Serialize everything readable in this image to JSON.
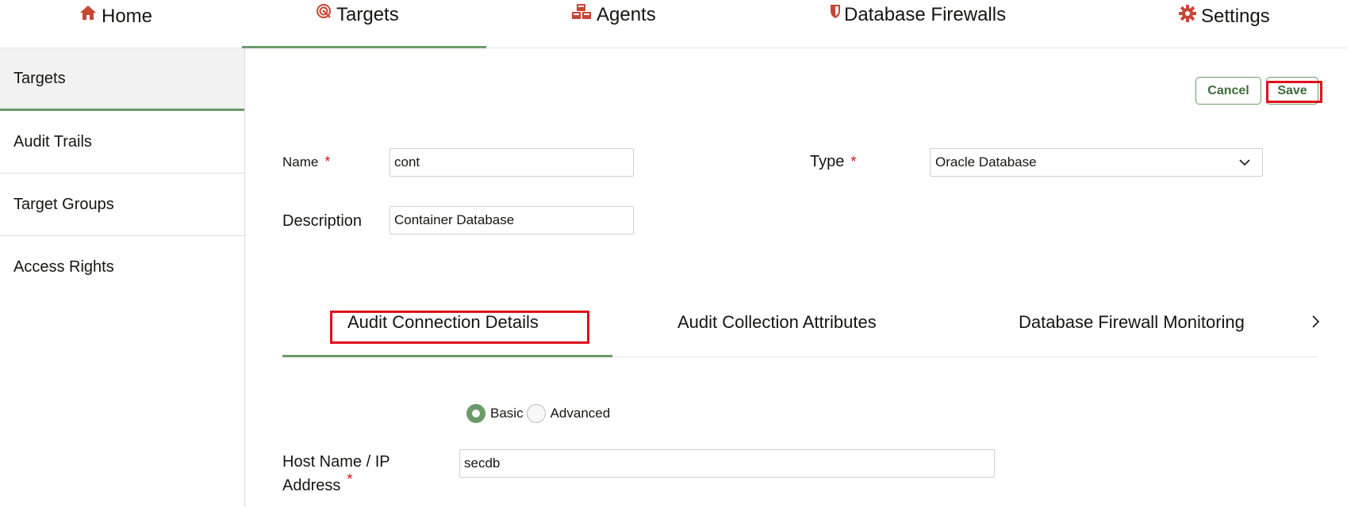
{
  "topnav": {
    "items": [
      {
        "label": "Home",
        "icon": "home-icon"
      },
      {
        "label": "Targets",
        "icon": "target-icon",
        "active": true
      },
      {
        "label": "Agents",
        "icon": "agents-icon"
      },
      {
        "label": "Database Firewalls",
        "icon": "shield-icon"
      },
      {
        "label": "Settings",
        "icon": "gear-icon"
      }
    ]
  },
  "sidebar": {
    "items": [
      {
        "label": "Targets",
        "active": true
      },
      {
        "label": "Audit Trails"
      },
      {
        "label": "Target Groups"
      },
      {
        "label": "Access Rights"
      }
    ]
  },
  "actions": {
    "cancel_label": "Cancel",
    "save_label": "Save"
  },
  "form": {
    "name_label": "Name",
    "name_value": "cont",
    "type_label": "Type",
    "type_value": "Oracle Database",
    "description_label": "Description",
    "description_value": "Container Database",
    "required_mark": "*"
  },
  "tabs": [
    {
      "label": "Audit Connection Details",
      "active": true
    },
    {
      "label": "Audit Collection Attributes"
    },
    {
      "label": "Database Firewall Monitoring"
    }
  ],
  "connection": {
    "mode_options": [
      {
        "label": "Basic",
        "checked": true
      },
      {
        "label": "Advanced",
        "checked": false
      }
    ],
    "host_label_line1": "Host Name / IP",
    "host_label_line2": "Address",
    "host_value": "secdb"
  },
  "colors": {
    "accent": "#6a9a6a",
    "brand_red": "#c74634",
    "highlight": "#e0101c"
  }
}
